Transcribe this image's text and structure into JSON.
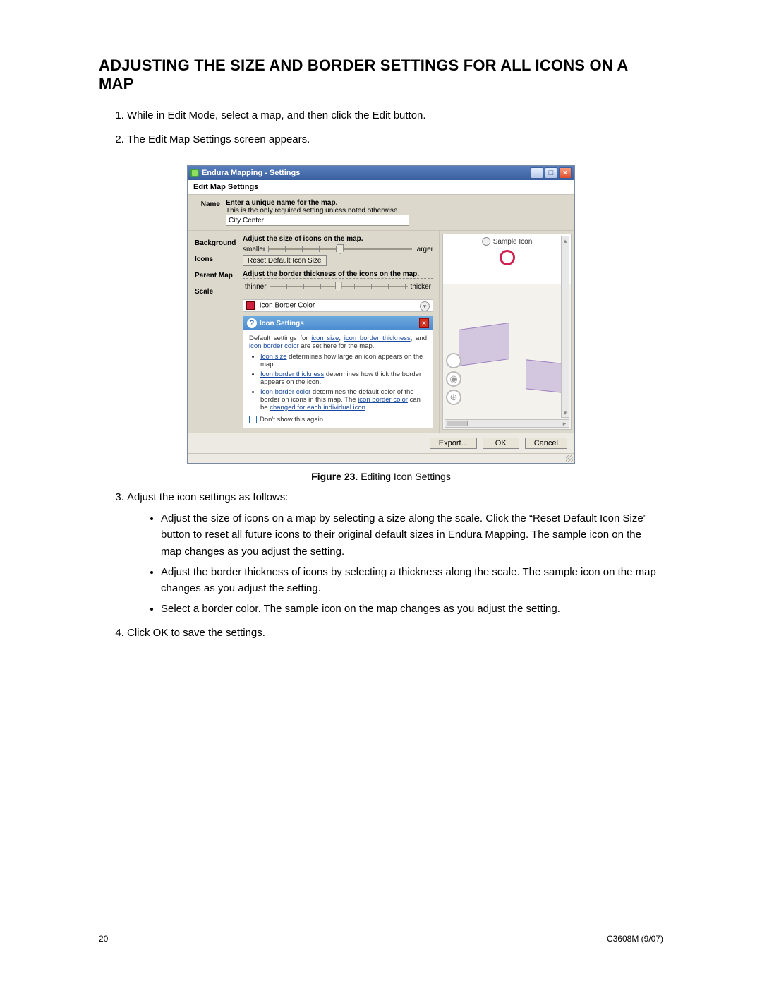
{
  "heading": "ADJUSTING THE SIZE AND BORDER SETTINGS FOR ALL ICONS ON A MAP",
  "steps": {
    "s1": "While in Edit Mode, select a map, and then click the Edit button.",
    "s2": "The Edit Map Settings screen appears.",
    "s3": "Adjust the icon settings as follows:",
    "s4": "Click OK to save the settings."
  },
  "bullets": {
    "b1": "Adjust the size of icons on a map by selecting a size along the scale. Click the “Reset Default Icon Size” button to reset all future icons to their original default sizes in Endura Mapping. The sample icon on the map changes as you adjust the setting.",
    "b2": "Adjust the border thickness of icons by selecting a thickness along the scale. The sample icon on the map changes as you adjust the setting.",
    "b3": "Select a border color. The sample icon on the map changes as you adjust the setting."
  },
  "figure": {
    "label": "Figure 23.",
    "caption": "Editing Icon Settings"
  },
  "footer": {
    "page": "20",
    "doc": "C3608M (9/07)"
  },
  "dialog": {
    "title": "Endura Mapping - Settings",
    "header": "Edit Map Settings",
    "name": {
      "label": "Name",
      "line1": "Enter a unique name for the map.",
      "line2": "This is the only required setting unless noted otherwise.",
      "value": "City Center"
    },
    "nav": {
      "background": "Background",
      "icons": "Icons",
      "parent": "Parent Map",
      "scale": "Scale"
    },
    "icons": {
      "sizeTitle": "Adjust the size of icons on the map.",
      "smaller": "smaller",
      "larger": "larger",
      "reset": "Reset Default Icon Size",
      "borderTitle": "Adjust the border thickness of the icons on the map.",
      "thinner": "thinner",
      "thicker": "thicker",
      "borderColor": "Icon Border Color"
    },
    "info": {
      "title": "Icon Settings",
      "intro1": "Default settings for ",
      "lk1": "icon size",
      "sep1": ", ",
      "lk2": "icon border thickness",
      "sep2": ", and ",
      "lk3": "icon border color",
      "intro2": " are set here for the map.",
      "li1a": "Icon size",
      "li1b": " determines how large an icon appears on the map.",
      "li2a": "Icon border thickness",
      "li2b": " determines how thick the border appears on the icon.",
      "li3a": "Icon border color",
      "li3b": " determines the default color of the border on icons in this map. The ",
      "li3c": "icon border color",
      "li3d": " can be ",
      "li3e": "changed for each individual icon",
      "li3f": ".",
      "dont": "Don't show this again."
    },
    "preview": {
      "sample": "Sample Icon"
    },
    "buttons": {
      "export": "Export...",
      "ok": "OK",
      "cancel": "Cancel"
    }
  }
}
